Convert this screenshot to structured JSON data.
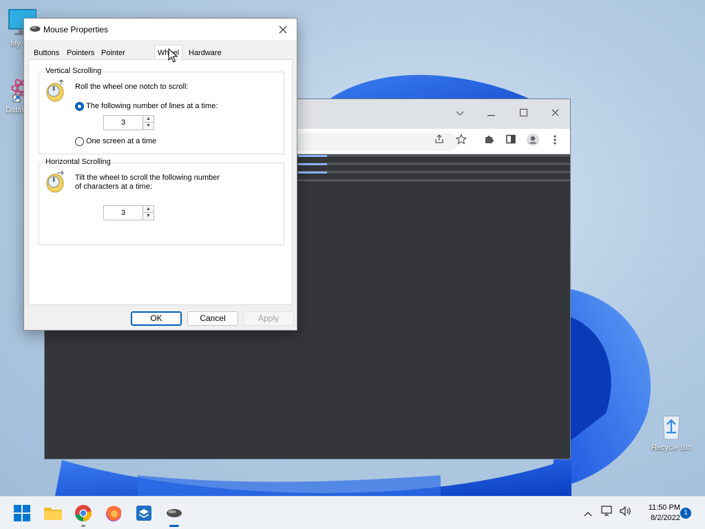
{
  "desktop": {
    "icons": [
      {
        "label": "My Co",
        "icon": "monitor-icon"
      },
      {
        "label": "DataW",
        "icon": "atom-icon"
      },
      {
        "label": "Recycle Bin",
        "icon": "recycle-bin-icon"
      }
    ]
  },
  "dialog": {
    "title": "Mouse Properties",
    "tabs": [
      {
        "label": "Buttons"
      },
      {
        "label": "Pointers"
      },
      {
        "label": "Pointer Options"
      },
      {
        "label": "Wheel",
        "active": true
      },
      {
        "label": "Hardware"
      }
    ],
    "vertical": {
      "title": "Vertical Scrolling",
      "instruction": "Roll the wheel one notch to scroll:",
      "option_lines": "The following number of lines at a time:",
      "lines_value": "3",
      "option_screen": "One screen at a time",
      "selected": "lines"
    },
    "horizontal": {
      "title": "Horizontal Scrolling",
      "instruction_line1": "Tilt the wheel to scroll the following number",
      "instruction_line2": "of characters at a time:",
      "chars_value": "3"
    },
    "buttons": {
      "ok": "OK",
      "cancel": "Cancel",
      "apply": "Apply"
    }
  },
  "taskbar": {
    "apps": [
      "start-icon",
      "file-explorer-icon",
      "chrome-icon",
      "firefox-icon",
      "app-box-icon",
      "mouse-icon"
    ],
    "clock_time": "11:50 PM",
    "clock_date": "8/2/2022",
    "notification_count": "1"
  },
  "colors": {
    "accent": "#005fb8",
    "dialog_bg": "#f0f0f0",
    "browser_bg": "#35363a"
  }
}
